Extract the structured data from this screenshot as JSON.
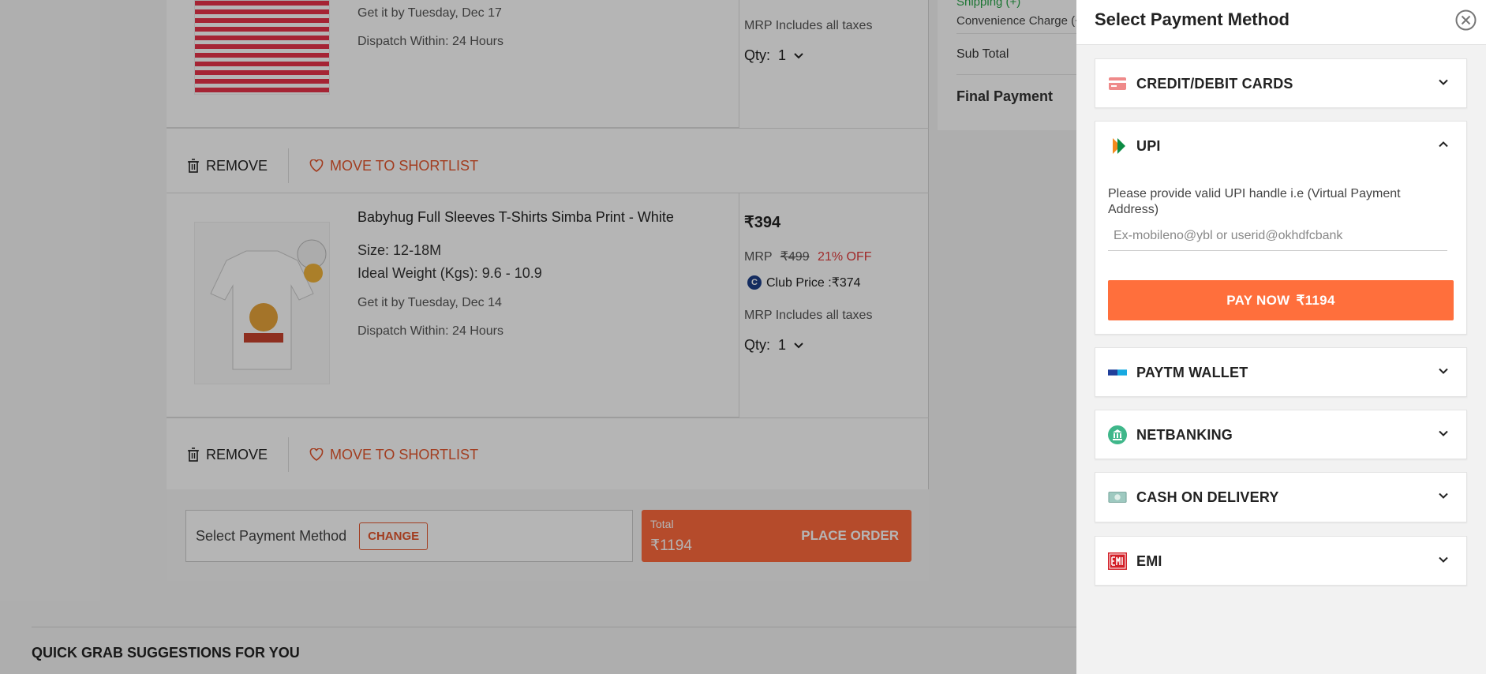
{
  "cart": {
    "items": [
      {
        "delivery": "Get it by Tuesday, Dec 17",
        "dispatch": "Dispatch Within: 24 Hours",
        "tax_note": "MRP Includes all taxes",
        "qty_label": "Qty:",
        "qty_value": "1"
      },
      {
        "name": "Babyhug Full Sleeves T-Shirts Simba Print - White",
        "size_label": "Size:",
        "size_value": "12-18M",
        "weight": "Ideal Weight (Kgs): 9.6 - 10.9",
        "delivery": "Get it by Tuesday, Dec 14",
        "dispatch": "Dispatch Within: 24 Hours",
        "price": "₹394",
        "mrp_label": "MRP",
        "mrp_value": "₹499",
        "discount": "21% OFF",
        "club_label": "Club Price :₹374",
        "tax_note": "MRP Includes all taxes",
        "qty_label": "Qty:",
        "qty_value": "1"
      }
    ],
    "remove_label": "REMOVE",
    "shortlist_label": "MOVE TO SHORTLIST",
    "pay_bar": {
      "select_label": "Select Payment Method",
      "change_label": "CHANGE",
      "total_label": "Total",
      "total_value": "₹1194",
      "place_order_label": "PLACE ORDER"
    }
  },
  "summary": {
    "shipping": "Shipping (+)",
    "convenience": "Convenience Charge (+",
    "sub_total": "Sub Total",
    "final_payment": "Final Payment"
  },
  "suggestions_title": "QUICK GRAB SUGGESTIONS FOR YOU",
  "drawer": {
    "title": "Select Payment Method",
    "methods": [
      {
        "label": "CREDIT/DEBIT CARDS",
        "icon": "card-icon"
      },
      {
        "label": "UPI",
        "icon": "upi-icon",
        "expanded": true
      },
      {
        "label": "PAYTM WALLET",
        "icon": "paytm-icon"
      },
      {
        "label": "NETBANKING",
        "icon": "bank-icon"
      },
      {
        "label": "CASH ON DELIVERY",
        "icon": "cash-icon"
      },
      {
        "label": "EMI",
        "icon": "emi-icon"
      }
    ],
    "upi": {
      "help_text": "Please provide valid UPI handle i.e (Virtual Payment Address)",
      "placeholder": "Ex-mobileno@ybl or userid@okhdfcbank",
      "pay_now_label": "PAY NOW",
      "pay_now_amount": "₹1194"
    }
  },
  "colors": {
    "accent": "#ff6a3d",
    "discount": "#e23b3b",
    "shortlist": "#e4572e",
    "shipping": "#2aa64a"
  }
}
